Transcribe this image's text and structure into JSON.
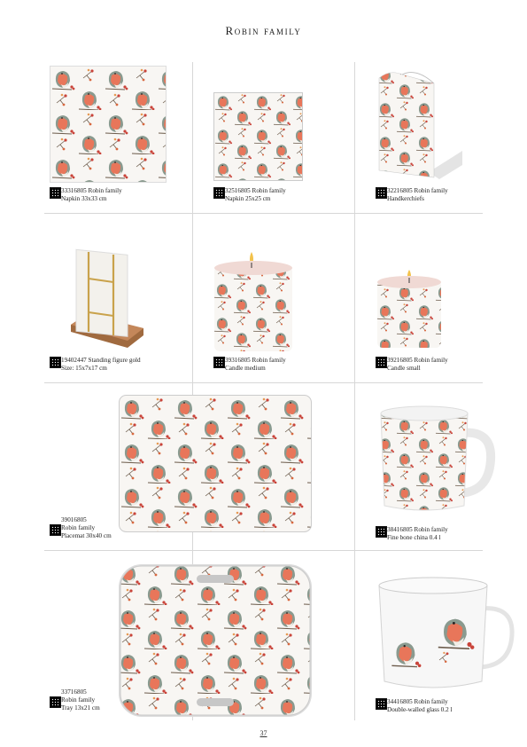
{
  "page": {
    "title": "Robin family",
    "page_number": "37"
  },
  "products": [
    {
      "line1": "33316805 Robin family",
      "line2": "Napkin 33x33 cm"
    },
    {
      "line1": "32516805 Robin family",
      "line2": "Napkin 25x25 cm"
    },
    {
      "line1": "32216805 Robin family",
      "line2": "Handkerchiefs"
    },
    {
      "line1": "19402447 Standing figure gold",
      "line2": "Size: 15x7x17 cm"
    },
    {
      "line1": "39316805 Robin family",
      "line2": "Candle medium"
    },
    {
      "line1": "39216805 Robin family",
      "line2": "Candle small"
    },
    {
      "line1": "39016805",
      "line2": "Robin family",
      "line3": "Placemat 30x40 cm"
    },
    {
      "line1": "38416805 Robin family",
      "line2": "Fine bone china 0.4 l"
    },
    {
      "line1": "33716805",
      "line2": "Robin family",
      "line3": "Tray 13x21 cm"
    },
    {
      "line1": "34416805 Robin family",
      "line2": "Double-walled glass 0.2 l"
    }
  ],
  "colors": {
    "robin_breast": "#e8765a",
    "robin_back": "#8a9a8f",
    "berry": "#c9443a",
    "branch": "#6b5a4a"
  }
}
